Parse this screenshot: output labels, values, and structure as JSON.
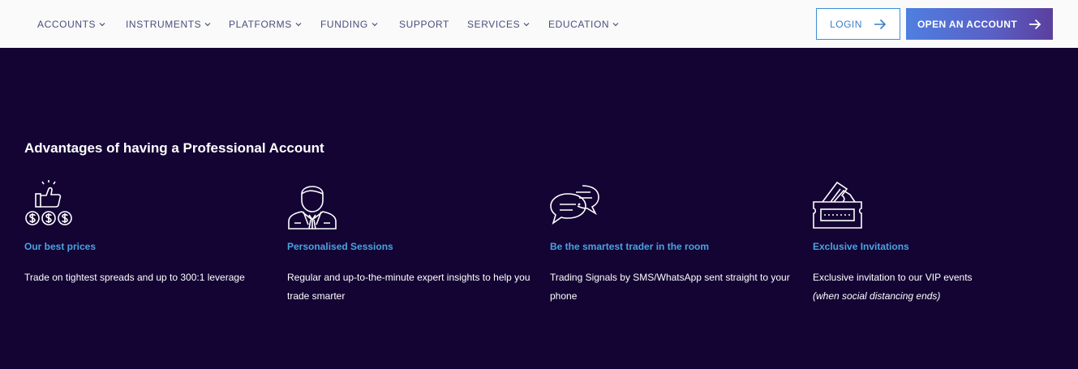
{
  "nav": {
    "items": [
      {
        "label": "ACCOUNTS",
        "dropdown": true
      },
      {
        "label": "INSTRUMENTS",
        "dropdown": true
      },
      {
        "label": "PLATFORMS",
        "dropdown": true
      },
      {
        "label": "FUNDING",
        "dropdown": true
      },
      {
        "label": "SUPPORT",
        "dropdown": false
      },
      {
        "label": "SERVICES",
        "dropdown": true
      },
      {
        "label": "EDUCATION",
        "dropdown": true
      }
    ],
    "login_label": "LOGIN",
    "open_account_label": "OPEN AN ACCOUNT"
  },
  "section": {
    "title": "Advantages of having a Professional Account",
    "features": [
      {
        "icon": "thumbs-up-coins-icon",
        "title": "Our best prices",
        "description": "Trade on tightest spreads and up to 300:1 leverage",
        "note": ""
      },
      {
        "icon": "person-suit-icon",
        "title": "Personalised Sessions",
        "description": "Regular and up-to-the-minute expert insights to help you trade smarter",
        "note": ""
      },
      {
        "icon": "chat-bubbles-icon",
        "title": "Be the smartest trader in the room",
        "description": "Trading Signals by SMS/WhatsApp sent straight to your phone",
        "note": ""
      },
      {
        "icon": "ticket-icon",
        "title": "Exclusive Invitations",
        "description": "Exclusive invitation to our VIP events",
        "note": "(when social distancing ends)"
      }
    ]
  },
  "colors": {
    "background": "#130434",
    "nav_text": "#4a4f7c",
    "feature_title": "#4aa3e0",
    "login_border": "#3b8fd6"
  }
}
